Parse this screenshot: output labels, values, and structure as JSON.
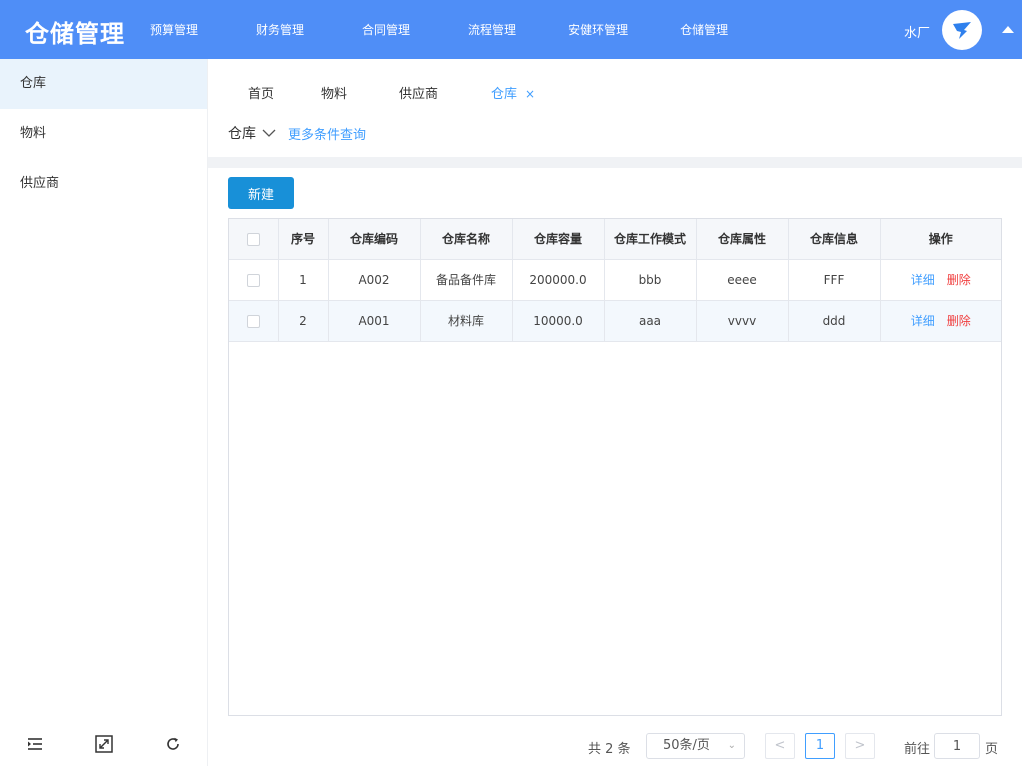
{
  "app": {
    "title": "仓储管理"
  },
  "topnav": {
    "items": [
      {
        "label": "预算管理"
      },
      {
        "label": "财务管理"
      },
      {
        "label": "合同管理"
      },
      {
        "label": "流程管理"
      },
      {
        "label": "安健环管理"
      },
      {
        "label": "仓储管理"
      }
    ]
  },
  "user": {
    "name": "水厂"
  },
  "sidebar": {
    "items": [
      {
        "label": "仓库",
        "active": true
      },
      {
        "label": "物料"
      },
      {
        "label": "供应商"
      }
    ]
  },
  "tabs": {
    "items": [
      {
        "label": "首页"
      },
      {
        "label": "物料"
      },
      {
        "label": "供应商"
      },
      {
        "label": "仓库",
        "active": true,
        "close": "×"
      }
    ]
  },
  "filter": {
    "label": "仓库",
    "more": "更多条件查询"
  },
  "toolbar": {
    "new_label": "新建"
  },
  "table": {
    "columns": [
      "序号",
      "仓库编码",
      "仓库名称",
      "仓库容量",
      "仓库工作模式",
      "仓库属性",
      "仓库信息",
      "操作"
    ],
    "rows": [
      {
        "index": "1",
        "code": "A002",
        "name": "备品备件库",
        "capacity": "200000.0",
        "mode": "bbb",
        "attr": "eeee",
        "info": "FFF"
      },
      {
        "index": "2",
        "code": "A001",
        "name": "材料库",
        "capacity": "10000.0",
        "mode": "aaa",
        "attr": "vvvv",
        "info": "ddd"
      }
    ],
    "actions": {
      "detail": "详细",
      "delete": "删除"
    }
  },
  "pagination": {
    "total": "共 2 条",
    "page_size": "50条/页",
    "current_page": "1",
    "goto_prefix": "前往",
    "goto_value": "1",
    "goto_suffix": "页",
    "prev": "<",
    "next": ">"
  },
  "colors": {
    "header_bg": "#4f8ef7",
    "accent": "#409eff",
    "danger": "#f03c3c",
    "button": "#1890d8"
  }
}
